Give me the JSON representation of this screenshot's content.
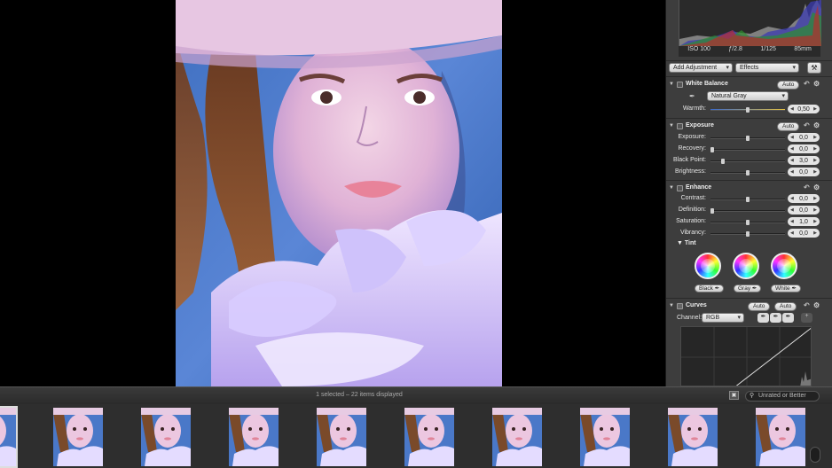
{
  "exif": {
    "iso": "ISO 100",
    "aperture": "ƒ/2.8",
    "shutter": "1/125",
    "focal": "85mm"
  },
  "toolbar": {
    "add_adjustment": "Add Adjustment",
    "effects": "Effects"
  },
  "white_balance": {
    "title": "White Balance",
    "auto": "Auto",
    "preset": "Natural Gray",
    "warmth_label": "Warmth:",
    "warmth_value": "0,50"
  },
  "exposure": {
    "title": "Exposure",
    "auto": "Auto",
    "rows": [
      {
        "label": "Exposure:",
        "value": "0,0",
        "pos": 0.5
      },
      {
        "label": "Recovery:",
        "value": "0,0",
        "pos": 0.0
      },
      {
        "label": "Black Point:",
        "value": "3,0",
        "pos": 0.15
      },
      {
        "label": "Brightness:",
        "value": "0,0",
        "pos": 0.5
      }
    ]
  },
  "enhance": {
    "title": "Enhance",
    "rows": [
      {
        "label": "Contrast:",
        "value": "0,0",
        "pos": 0.5
      },
      {
        "label": "Definition:",
        "value": "0,0",
        "pos": 0.0
      },
      {
        "label": "Saturation:",
        "value": "1,0",
        "pos": 0.5
      },
      {
        "label": "Vibrancy:",
        "value": "0,0",
        "pos": 0.5
      }
    ],
    "tint_title": "Tint",
    "wheels": [
      "Black",
      "Gray",
      "White"
    ]
  },
  "curves": {
    "title": "Curves",
    "auto1": "Auto",
    "auto2": "Auto",
    "channel_label": "Channel:",
    "channel_value": "RGB"
  },
  "filmstrip": {
    "status": "1 selected – 22 items displayed",
    "filter": "Unrated or Better",
    "thumb_count": 10
  },
  "colors": {
    "panel": "#3d3d3d",
    "accent": "#e4e4e4"
  }
}
